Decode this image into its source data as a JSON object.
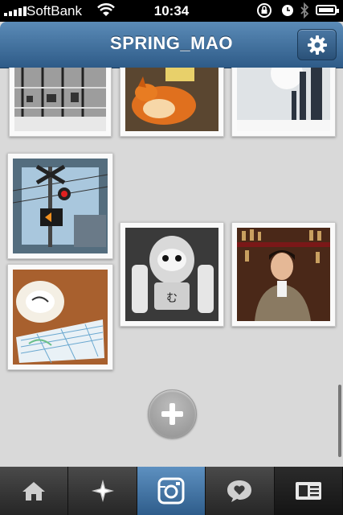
{
  "status_bar": {
    "carrier": "SoftBank",
    "time": "10:34",
    "icons": [
      "signal-icon",
      "wifi-icon",
      "rotation-lock-icon",
      "alarm-icon",
      "bluetooth-icon",
      "battery-icon"
    ]
  },
  "header": {
    "title": "SPRING_MAO",
    "settings_icon": "gear-icon"
  },
  "photos": [
    {
      "name": "photo-railway-bw"
    },
    {
      "name": "photo-shiba-dog"
    },
    {
      "name": "photo-snowy-street"
    },
    {
      "name": "photo-railroad-crossing"
    },
    {
      "name": "photo-daruma-bw"
    },
    {
      "name": "photo-man-bar"
    },
    {
      "name": "photo-cup-note"
    }
  ],
  "add_button": {
    "icon": "plus-icon"
  },
  "tabs": [
    {
      "name": "tab-home",
      "icon": "home-icon",
      "active": false
    },
    {
      "name": "tab-explore",
      "icon": "star-icon",
      "active": false
    },
    {
      "name": "tab-camera",
      "icon": "camera-icon",
      "active": true
    },
    {
      "name": "tab-news",
      "icon": "heart-bubble-icon",
      "active": false
    },
    {
      "name": "tab-profile",
      "icon": "profile-card-icon",
      "active": false
    }
  ],
  "colors": {
    "header_top": "#5b8bb7",
    "header_bottom": "#2e5b88",
    "active_tab": "#4a7aaa",
    "background": "#d9d9d9"
  }
}
